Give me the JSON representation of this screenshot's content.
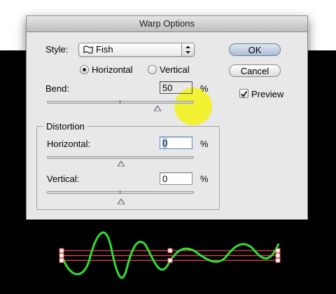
{
  "window": {
    "title": "Warp Options"
  },
  "style": {
    "label": "Style:",
    "value": "Fish",
    "icon": "fish-warp-icon"
  },
  "orientation": {
    "horizontal_label": "Horizontal",
    "vertical_label": "Vertical",
    "selected": "horizontal"
  },
  "bend": {
    "label": "Bend:",
    "value": "50",
    "unit": "%",
    "level": 0.75
  },
  "distortion": {
    "title": "Distortion",
    "horizontal": {
      "label": "Horizontal:",
      "value": "0",
      "unit": "%",
      "level": 0.5
    },
    "vertical": {
      "label": "Vertical:",
      "value": "0",
      "unit": "%",
      "level": 0.5
    }
  },
  "buttons": {
    "ok_label": "OK",
    "cancel_label": "Cancel"
  },
  "preview": {
    "label": "Preview",
    "checked": true
  },
  "colors": {
    "highlight": "#f2f228",
    "wave": "#33dd33",
    "bounding_lines": "#e05050"
  }
}
